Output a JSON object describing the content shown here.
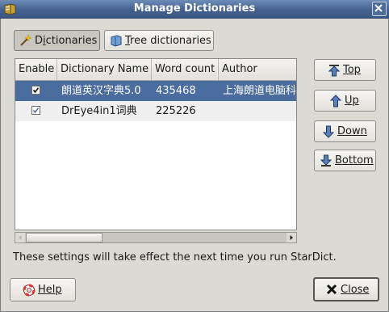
{
  "window": {
    "title": "Manage Dictionaries",
    "close_icon": "close-icon"
  },
  "tabs": [
    {
      "label": "Dictionaries",
      "mnemonic": "i",
      "icon": "wand-icon",
      "active": true
    },
    {
      "label": "Tree dictionaries",
      "mnemonic": "T",
      "icon": "book-icon",
      "active": false
    }
  ],
  "table": {
    "columns": [
      "Enable",
      "Dictionary Name",
      "Word count",
      "Author"
    ],
    "rows": [
      {
        "enabled": true,
        "name": "朗道英汉字典5.0",
        "word_count": "435468",
        "author": "上海朗道电脑科",
        "selected": true
      },
      {
        "enabled": true,
        "name": "DrEye4in1词典",
        "word_count": "225226",
        "author": "",
        "selected": false
      }
    ]
  },
  "side_buttons": {
    "top": "Top",
    "up": "Up",
    "down": "Down",
    "bottom": "Bottom"
  },
  "notice": "These settings will take effect the next time you run StarDict.",
  "footer": {
    "help": "Help",
    "close": "Close"
  },
  "colors": {
    "title_bar": "#44618f",
    "selection": "#4b6c9e",
    "background": "#dcdad5"
  }
}
